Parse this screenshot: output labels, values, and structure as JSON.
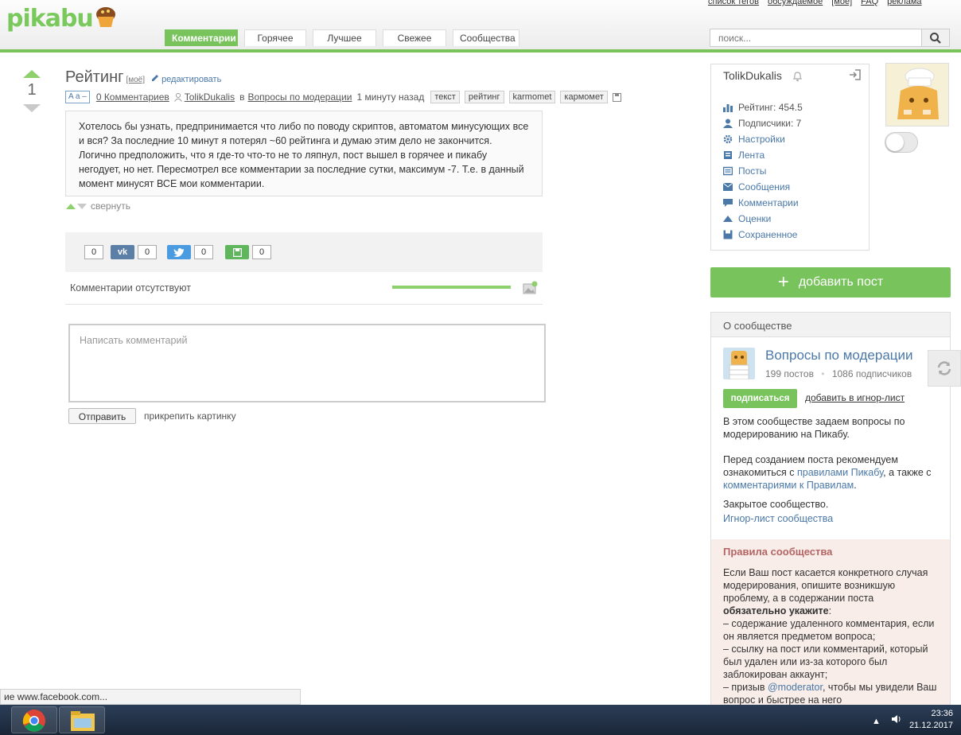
{
  "header": {
    "logo_text": "pikabu",
    "top_links": [
      "список тегов",
      "обсуждаемое",
      "[моё]",
      "FAQ",
      "реклама"
    ],
    "tabs": [
      {
        "label": "Комментарии",
        "active": true
      },
      {
        "label": "Горячее",
        "active": false
      },
      {
        "label": "Лучшее",
        "active": false
      },
      {
        "label": "Свежее",
        "active": false
      },
      {
        "label": "Сообщества",
        "active": false
      }
    ],
    "search_placeholder": "поиск..."
  },
  "post": {
    "rating": "1",
    "title": "Рейтинг",
    "moe_label": "[моё]",
    "edit_label": "редактировать",
    "font_toggle": "A a –",
    "comments_link": "0 Комментариев",
    "author": "TolikDukalis",
    "in_word": "в",
    "community": "Вопросы по модерации",
    "time": "1 минуту назад",
    "tags": [
      "текст",
      "рейтинг",
      "karmomet",
      "кармомет"
    ],
    "body": "Хотелось бы узнать, предпринимается что либо по поводу скриптов, автоматом минусующих все и вся? За последние 10 минут я потерял ~60 рейтинга и думаю этим дело не закончится. Логично предположить, что я где-то что-то не то ляпнул, пост вышел в горячее и пикабу негодует, но нет. Пересмотрел все комментарии за последние сутки, максимум -7. Т.е. в данный момент минусят ВСЕ мои комментарии.",
    "collapse_label": "свернуть"
  },
  "share": {
    "counts": [
      "0",
      "0",
      "0",
      "0"
    ],
    "vk_label": "vk"
  },
  "comments": {
    "none_label": "Комментарии отсутствуют",
    "placeholder": "Написать комментарий",
    "send_label": "Отправить",
    "attach_label": "прикрепить картинку"
  },
  "user": {
    "name": "TolikDukalis",
    "menu": [
      {
        "label": "Рейтинг: 454.5",
        "icon": "rating-icon",
        "link": false
      },
      {
        "label": "Подписчики: 7",
        "icon": "subscribers-icon",
        "link": false
      },
      {
        "label": "Настройки",
        "icon": "gear-icon",
        "link": true
      },
      {
        "label": "Лента",
        "icon": "feed-icon",
        "link": true
      },
      {
        "label": "Посты",
        "icon": "posts-icon",
        "link": true
      },
      {
        "label": "Сообщения",
        "icon": "mail-icon",
        "link": true
      },
      {
        "label": "Комментарии",
        "icon": "comments-icon",
        "link": true
      },
      {
        "label": "Оценки",
        "icon": "votes-icon",
        "link": true
      },
      {
        "label": "Сохраненное",
        "icon": "saved-icon",
        "link": true
      }
    ]
  },
  "sidebar": {
    "add_post_label": "добавить пост",
    "about_title": "О сообществе",
    "community_name": "Вопросы по модерации",
    "posts_count": "199 постов",
    "subscribers_count": "1086 подписчиков",
    "subscribe_label": "подписаться",
    "ignore_label": "добавить в игнор-лист",
    "desc1": "В этом сообществе задаем вопросы по модерированию на Пикабу.",
    "desc2_pre": "Перед созданием поста рекомендуем ознакомиться с ",
    "desc2_link1": "правилами Пикабу",
    "desc2_mid": ", а также с ",
    "desc2_link2": "комментариями к Правилам",
    "desc2_post": ".",
    "closed_label": "Закрытое сообщество.",
    "ignore_list_label": "Игнор-лист сообщества",
    "rules_title": "Правила сообщества",
    "rules_p1": "Если Ваш пост касается конкретного случая модерирования, опишите возникшую проблему, а в содержании поста",
    "rules_bold": "обязательно укажите",
    "rules_colon": ":",
    "rules_l1": "– содержание удаленного комментария, если он является предметом вопроса;",
    "rules_l2": "– ссылку на пост или комментарий, который был удален или из-за которого был заблокирован аккаунт;",
    "rules_l3_pre": "– призыв ",
    "rules_l3_link": "@moderator",
    "rules_l3_post": ", чтобы мы увидели Ваш вопрос и быстрее на него"
  },
  "browser": {
    "status_text": "ие www.facebook.com...",
    "clock_time": "23:36",
    "clock_date": "21.12.2017"
  },
  "colors": {
    "brand_green": "#78c35c",
    "link_blue": "#4a78a8",
    "rules_title": "#b36565"
  }
}
